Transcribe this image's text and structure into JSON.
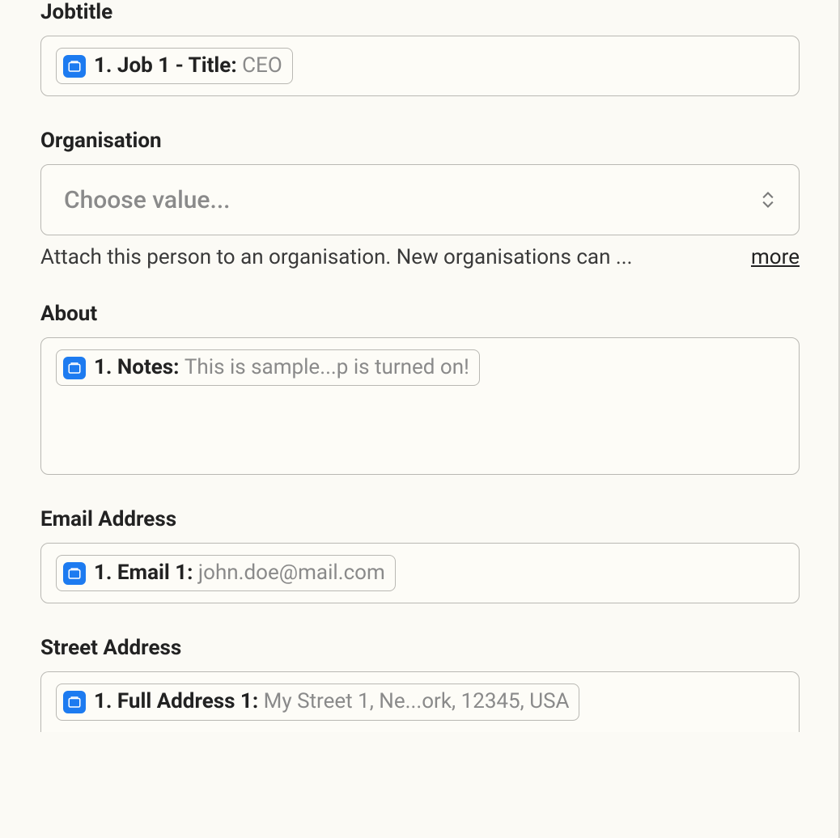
{
  "fields": {
    "jobtitle": {
      "label": "Jobtitle",
      "pill_label": "1. Job 1 - Title: ",
      "pill_value": "CEO"
    },
    "organisation": {
      "label": "Organisation",
      "placeholder": "Choose value...",
      "hint": "Attach this person to an organisation. New organisations can ...",
      "more": "more"
    },
    "about": {
      "label": "About",
      "pill_label": "1. Notes: ",
      "pill_value": "This is sample...p is turned on!"
    },
    "email": {
      "label": "Email Address",
      "pill_label": "1. Email 1: ",
      "pill_value": "john.doe@mail.com"
    },
    "street": {
      "label": "Street Address",
      "pill_label": "1. Full Address 1: ",
      "pill_value": "My Street 1, Ne...ork, 12345, USA"
    }
  }
}
